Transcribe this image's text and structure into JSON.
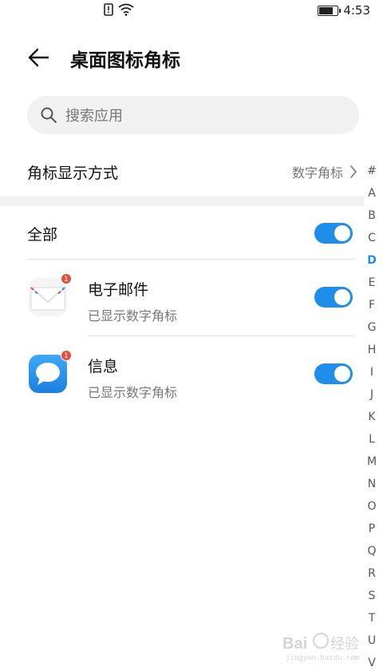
{
  "status_bar": {
    "time": "4:53",
    "battery_level": 0.8,
    "icons": [
      "sim-alert-icon",
      "wifi-icon",
      "battery-icon"
    ]
  },
  "header": {
    "title": "桌面图标角标",
    "back_icon": "arrow-left-icon"
  },
  "search": {
    "placeholder": "搜索应用",
    "icon": "search-icon"
  },
  "badge_style": {
    "label": "角标显示方式",
    "value": "数字角标"
  },
  "all_toggle": {
    "label": "全部",
    "on": true
  },
  "apps": [
    {
      "name": "电子邮件",
      "status": "已显示数字角标",
      "badge_count": "1",
      "icon": "email-icon",
      "on": true
    },
    {
      "name": "信息",
      "status": "已显示数字角标",
      "badge_count": "1",
      "icon": "message-icon",
      "on": true
    }
  ],
  "index_bar": {
    "letters": [
      "#",
      "A",
      "B",
      "C",
      "D",
      "E",
      "F",
      "G",
      "H",
      "I",
      "J",
      "K",
      "L",
      "M",
      "N",
      "O",
      "P",
      "Q",
      "R",
      "S",
      "T",
      "U",
      "V"
    ],
    "active": "D"
  },
  "colors": {
    "accent": "#1e8eea",
    "badge": "#e84c3d",
    "search_bg": "#f1f1f1",
    "secondary_text": "#777777"
  },
  "watermark_text": "Baidu 经验"
}
